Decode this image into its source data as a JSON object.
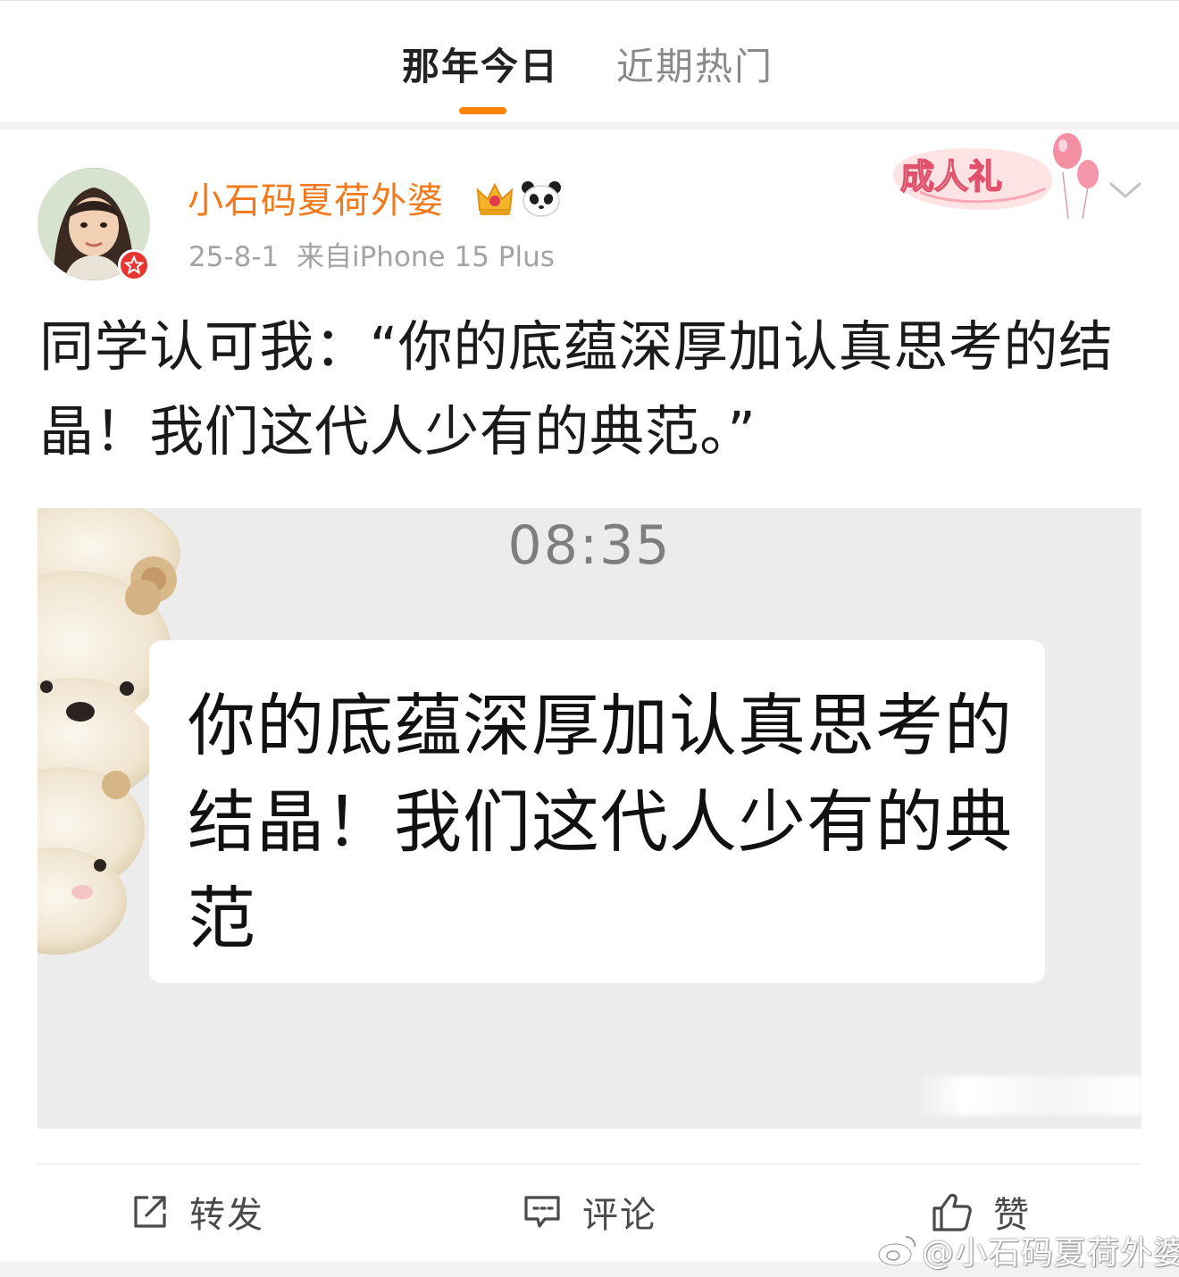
{
  "tabs": {
    "active_label": "那年今日",
    "inactive_label": "近期热门"
  },
  "colors": {
    "accent": "#ff8200",
    "username": "#f2791c",
    "verify_badge": "#e8352f"
  },
  "post": {
    "author": "小石码夏荷外婆",
    "author_badges": [
      "crown-icon",
      "panda-icon"
    ],
    "date": "25-8-1",
    "source": "来自iPhone 15 Plus",
    "decoration_badge": "成人礼",
    "text": "同学认可我：“你的底蕴深厚加认真思考的结晶！我们这代人少有的典范。”",
    "image": {
      "chat_time": "08:35",
      "message": "你的底蕴深厚加认真思考的结晶！我们这代人少有的典范"
    }
  },
  "actions": {
    "repost_label": "转发",
    "comment_label": "评论",
    "like_label": "赞"
  },
  "watermark": "@小石码夏荷外婆"
}
